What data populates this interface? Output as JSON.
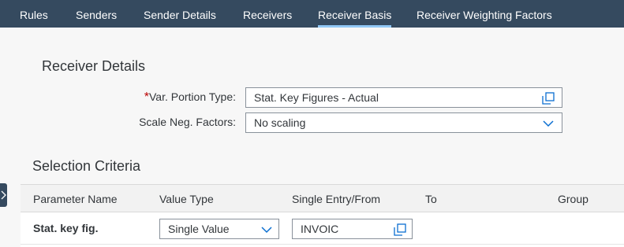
{
  "tabs": [
    {
      "label": "Rules",
      "selected": false
    },
    {
      "label": "Senders",
      "selected": false
    },
    {
      "label": "Sender Details",
      "selected": false
    },
    {
      "label": "Receivers",
      "selected": false
    },
    {
      "label": "Receiver Basis",
      "selected": true
    },
    {
      "label": "Receiver Weighting Factors",
      "selected": false
    }
  ],
  "receiver_details": {
    "title": "Receiver Details",
    "var_portion_type": {
      "required_mark": "*",
      "label": "Var. Portion Type:",
      "value": "Stat. Key Figures - Actual",
      "icon": "value-help-icon"
    },
    "scale_neg_factors": {
      "label": "Scale Neg. Factors:",
      "value": "No scaling",
      "icon": "chevron-down-icon"
    }
  },
  "selection_criteria": {
    "title": "Selection Criteria",
    "columns": [
      "Parameter Name",
      "Value Type",
      "Single Entry/From",
      "To",
      "Group"
    ],
    "rows": [
      {
        "parameter": "Stat. key fig.",
        "value_type": "Single Value",
        "single_entry_from": "INVOIC",
        "to": "",
        "group": ""
      }
    ]
  },
  "colors": {
    "header_bg": "#354a5f",
    "tab_indicator": "#91c8f6",
    "required": "#bb0000",
    "page_bg": "#f7f7f7"
  }
}
